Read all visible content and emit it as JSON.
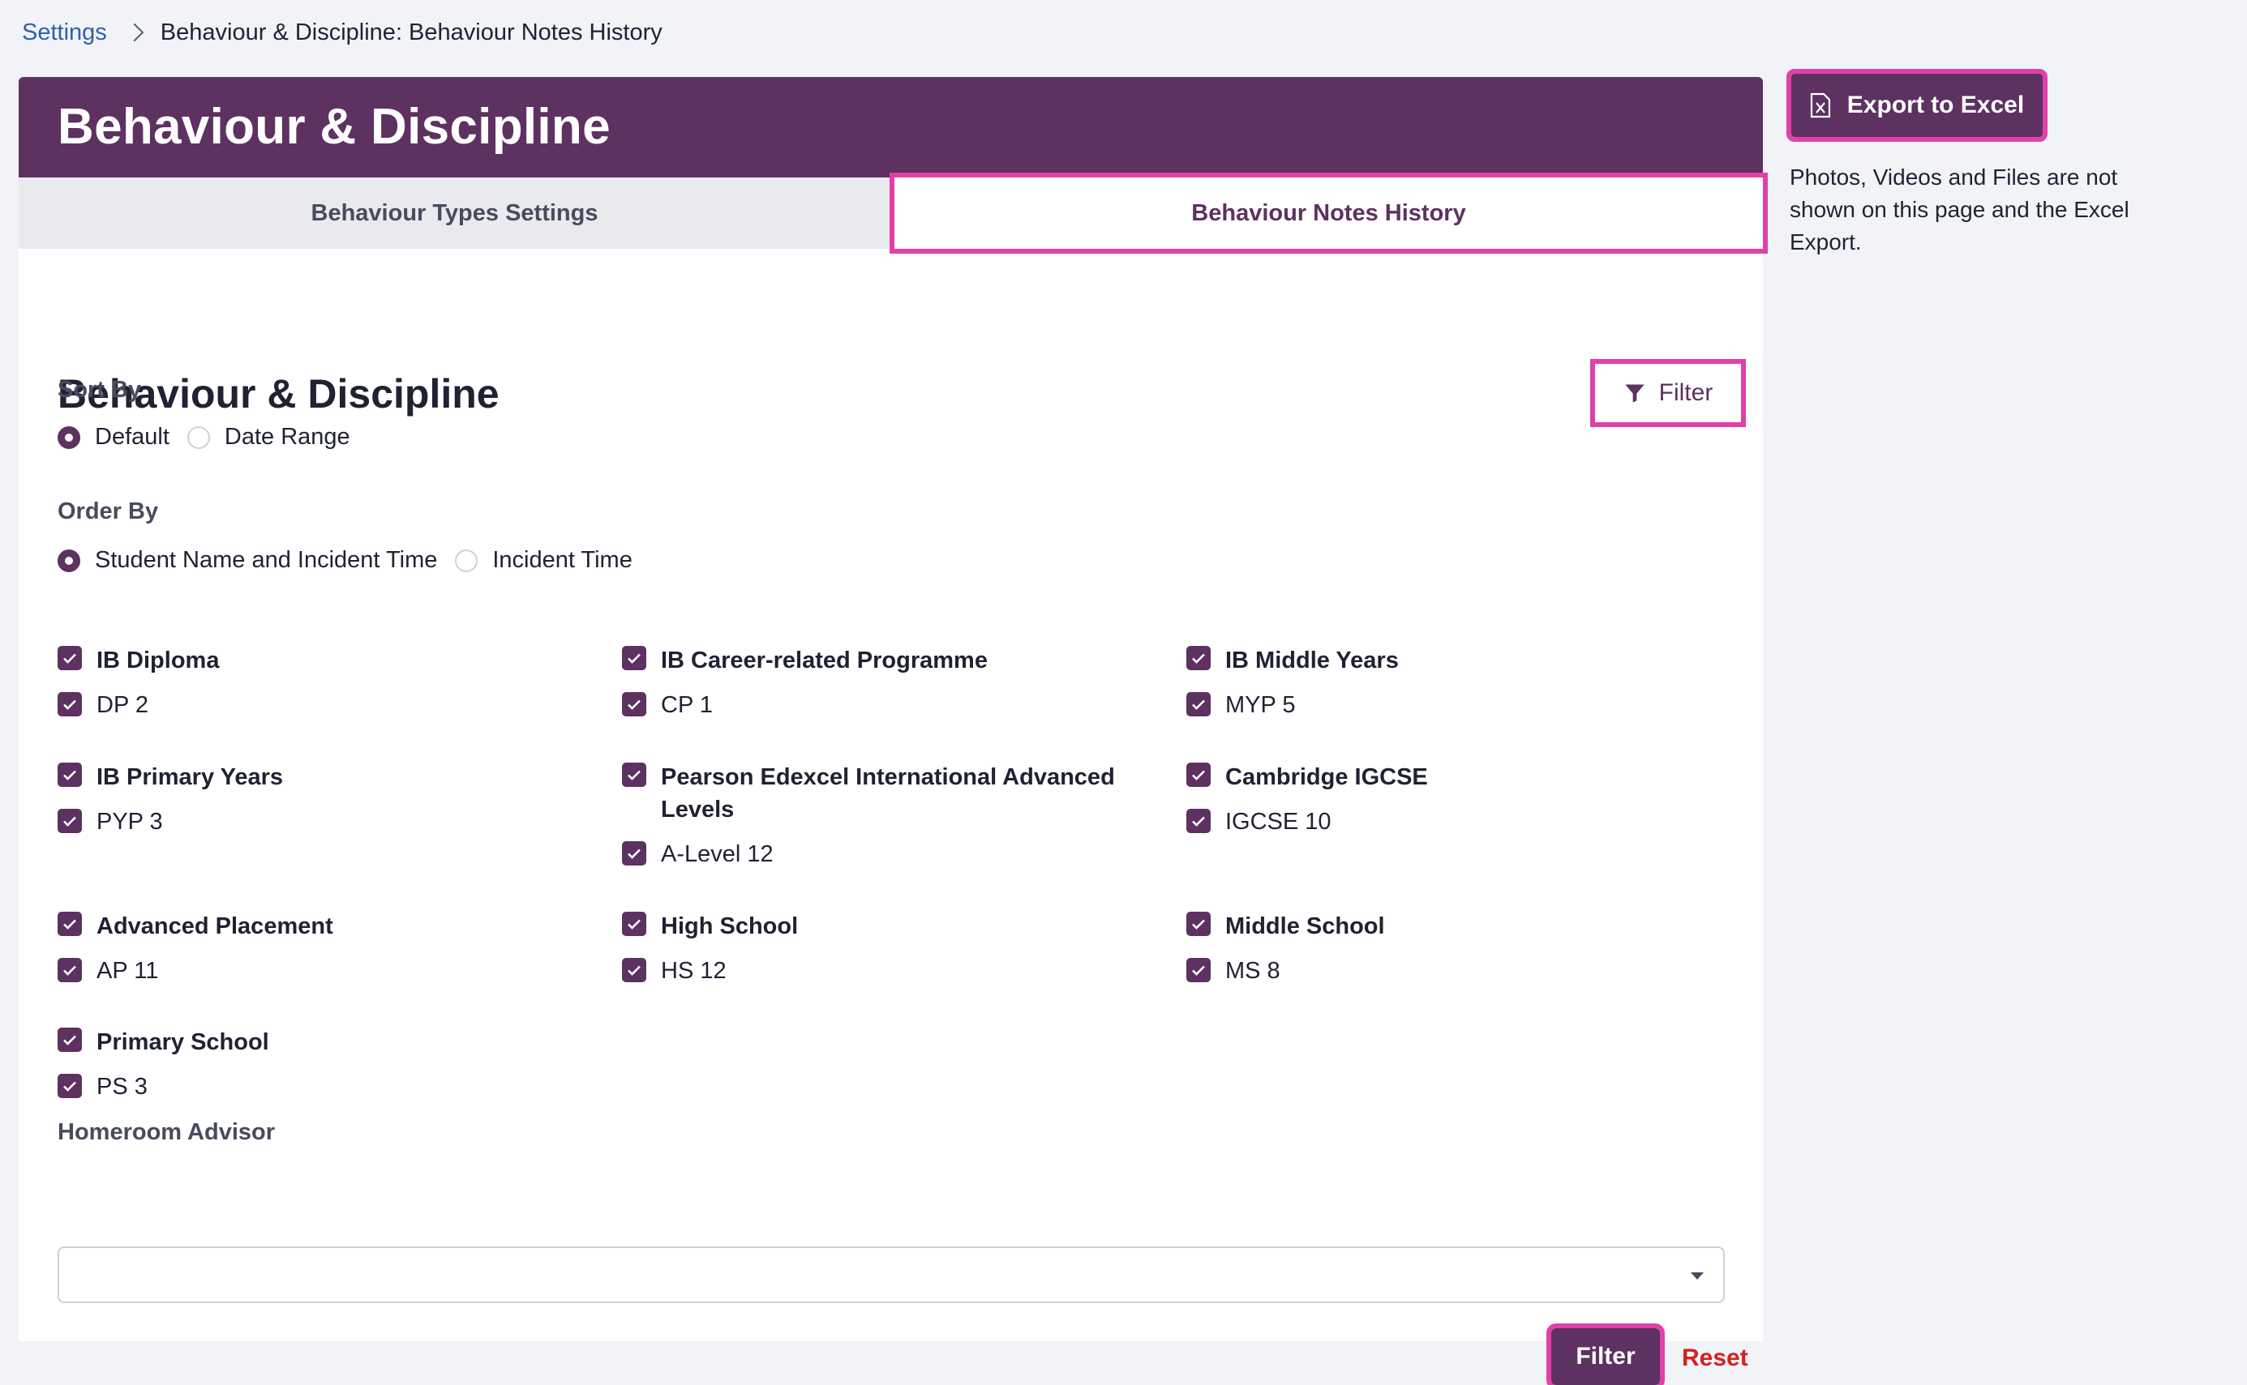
{
  "breadcrumb": {
    "link": "Settings",
    "current": "Behaviour & Discipline: Behaviour Notes History"
  },
  "card": {
    "title": "Behaviour & Discipline"
  },
  "tabs": [
    {
      "label": "Behaviour Types Settings",
      "active": false
    },
    {
      "label": "Behaviour Notes History",
      "active": true
    }
  ],
  "section": {
    "title": "Behaviour & Discipline",
    "filter_label": "Filter"
  },
  "sort_by": {
    "label": "Sort By",
    "options": [
      {
        "label": "Default",
        "selected": true
      },
      {
        "label": "Date Range",
        "selected": false
      }
    ]
  },
  "order_by": {
    "label": "Order By",
    "options": [
      {
        "label": "Student Name and Incident Time",
        "selected": true
      },
      {
        "label": "Incident Time",
        "selected": false
      }
    ]
  },
  "programmes": [
    {
      "name": "IB Diploma",
      "checked": true,
      "children": [
        {
          "name": "DP 2",
          "checked": true
        }
      ]
    },
    {
      "name": "IB Career-related Programme",
      "checked": true,
      "children": [
        {
          "name": "CP 1",
          "checked": true
        }
      ]
    },
    {
      "name": "IB Middle Years",
      "checked": true,
      "children": [
        {
          "name": "MYP 5",
          "checked": true
        }
      ]
    },
    {
      "name": "IB Primary Years",
      "checked": true,
      "children": [
        {
          "name": "PYP 3",
          "checked": true
        }
      ]
    },
    {
      "name": "Pearson Edexcel International Advanced Levels",
      "checked": true,
      "children": [
        {
          "name": "A-Level 12",
          "checked": true
        }
      ]
    },
    {
      "name": "Cambridge IGCSE",
      "checked": true,
      "children": [
        {
          "name": "IGCSE 10",
          "checked": true
        }
      ]
    },
    {
      "name": "Advanced Placement",
      "checked": true,
      "children": [
        {
          "name": "AP 11",
          "checked": true
        }
      ]
    },
    {
      "name": "High School",
      "checked": true,
      "children": [
        {
          "name": "HS 12",
          "checked": true
        }
      ]
    },
    {
      "name": "Middle School",
      "checked": true,
      "children": [
        {
          "name": "MS 8",
          "checked": true
        }
      ]
    },
    {
      "name": "Primary School",
      "checked": true,
      "children": [
        {
          "name": "PS 3",
          "checked": true
        }
      ]
    }
  ],
  "homeroom": {
    "label": "Homeroom Advisor",
    "value": ""
  },
  "actions": {
    "filter": "Filter",
    "reset": "Reset"
  },
  "export": {
    "label": "Export to Excel",
    "note": "Photos, Videos and Files are not shown on this page and the Excel Export."
  },
  "colors": {
    "brand": "#5d3160",
    "highlight": "#e040a8",
    "reset": "#d6201f",
    "link": "#2f5fae"
  }
}
